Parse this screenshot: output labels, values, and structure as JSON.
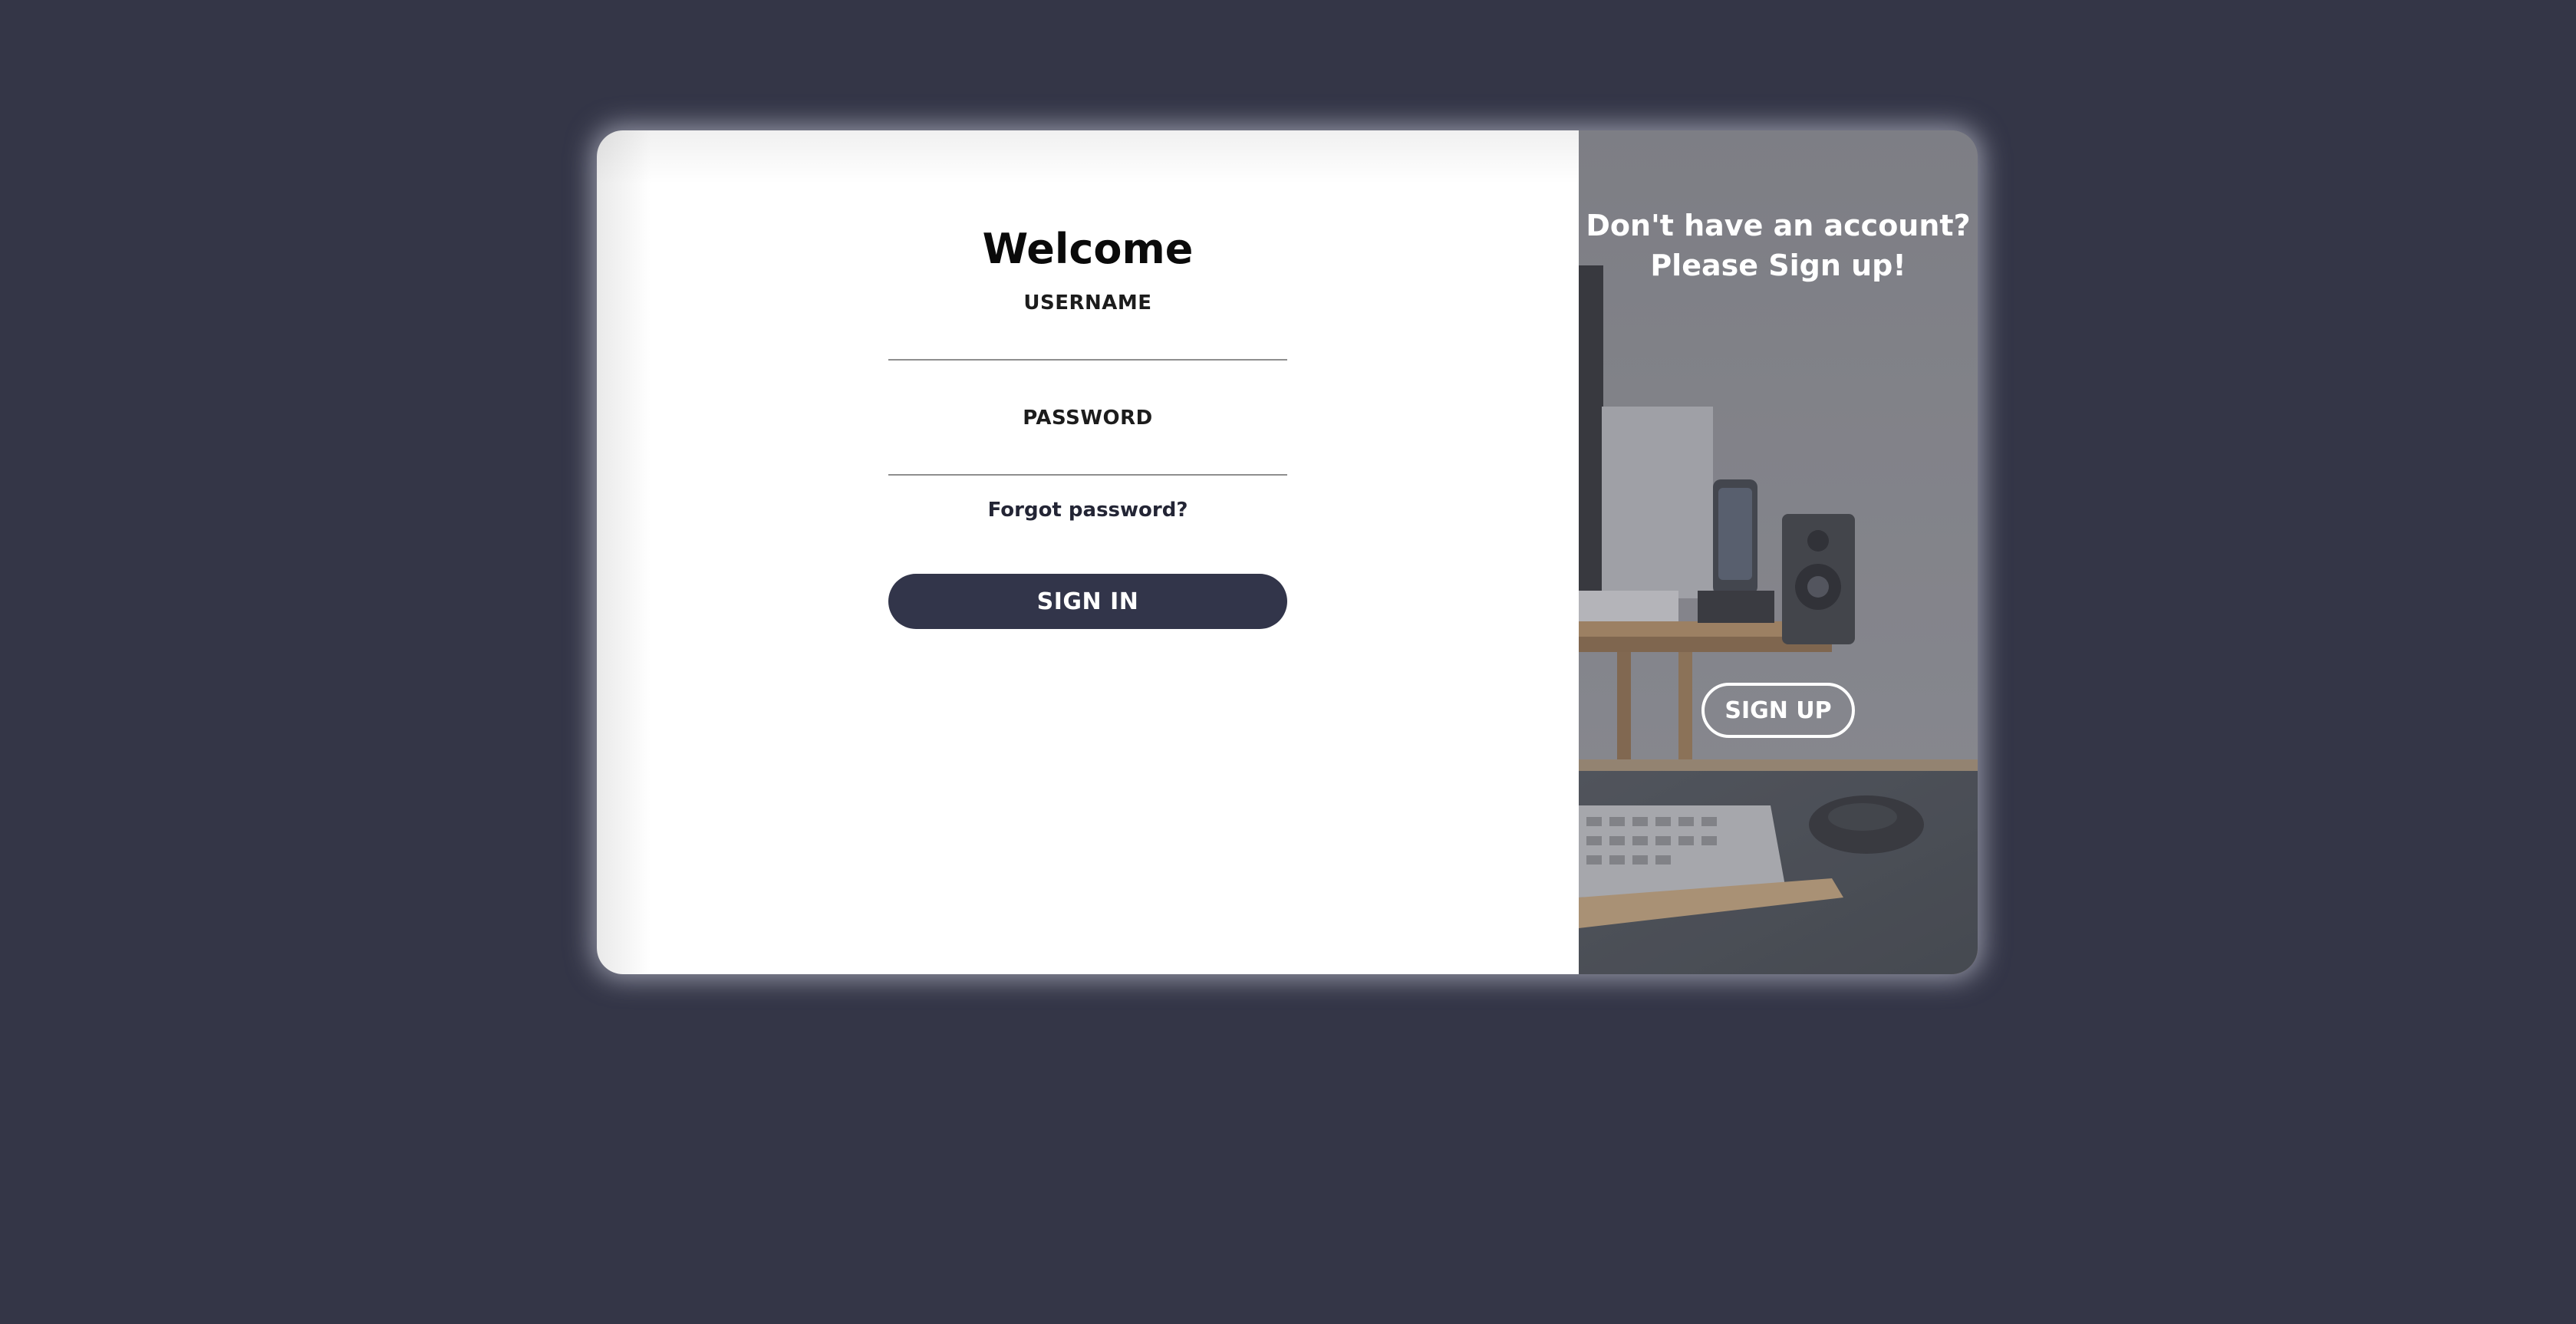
{
  "signin": {
    "title": "Welcome",
    "username_label": "USERNAME",
    "username_value": "",
    "password_label": "PASSWORD",
    "password_value": "",
    "forgot_label": "Forgot password?",
    "button_label": "SIGN IN"
  },
  "signup": {
    "prompt_line1": "Don't have an account?",
    "prompt_line2": "Please Sign up!",
    "button_label": "SIGN UP"
  },
  "colors": {
    "page_background": "#343647",
    "primary_button": "#32354a",
    "card_background": "#ffffff",
    "panel_overlay": "#7b7c81"
  }
}
